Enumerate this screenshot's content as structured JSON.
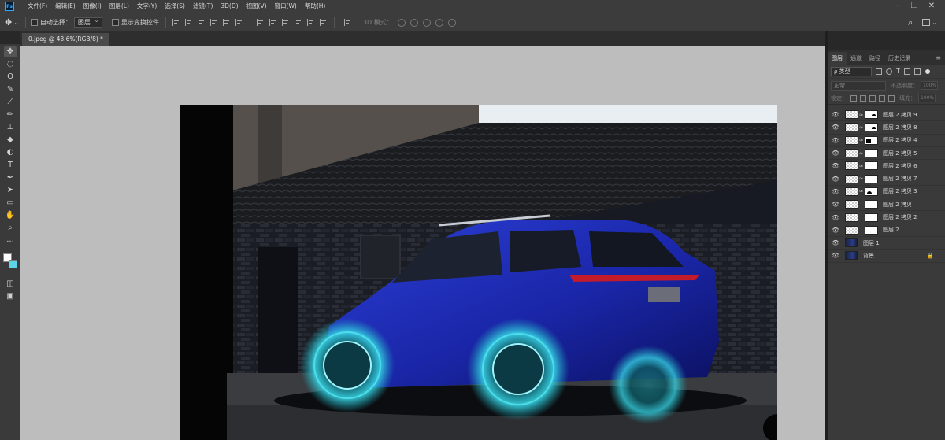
{
  "app": {
    "logo_text": "Ps"
  },
  "menu": [
    "文件(F)",
    "编辑(E)",
    "图像(I)",
    "图层(L)",
    "文字(Y)",
    "选择(S)",
    "滤镜(T)",
    "3D(D)",
    "视图(V)",
    "窗口(W)",
    "帮助(H)"
  ],
  "options": {
    "move_tool_icon": "move-icon",
    "auto_select_label": "自动选择：",
    "auto_select_value": "图层",
    "show_transform_label": "显示变换控件",
    "mode3d_label": "3D 模式："
  },
  "document": {
    "tab_title": "0.jpeg @ 48.6%(RGB/8) *"
  },
  "tools": [
    "move-icon",
    "marquee-icon",
    "lasso-icon",
    "quick-select-icon",
    "eyedropper-icon",
    "brush-icon",
    "stamp-icon",
    "eraser-icon",
    "bucket-icon",
    "text-icon",
    "pen-icon",
    "path-select-icon",
    "rectangle-icon",
    "hand-icon",
    "zoom-icon",
    "more-icon"
  ],
  "colors": {
    "foreground": "#ffffff",
    "background": "#5fd3e8",
    "canvas_bg": "#bdbdbd"
  },
  "panels": {
    "tabs": [
      "图层",
      "通道",
      "路径",
      "历史记录"
    ],
    "kind_label": "ρ 类型",
    "blend_mode": "正常",
    "opacity_label": "不透明度：",
    "opacity_value": "100%",
    "lock_label": "锁定：",
    "fill_label": "填充：",
    "fill_value": "100%"
  },
  "layers": [
    {
      "name": "图层 2 拷贝 9",
      "thumb": "transparent",
      "mask": "m1"
    },
    {
      "name": "图层 2 拷贝 8",
      "thumb": "transparent",
      "mask": "m1"
    },
    {
      "name": "图层 2 拷贝 4",
      "thumb": "transparent",
      "mask": "m2"
    },
    {
      "name": "图层 2 拷贝 5",
      "thumb": "transparent",
      "mask": "plain"
    },
    {
      "name": "图层 2 拷贝 6",
      "thumb": "transparent",
      "mask": "plain"
    },
    {
      "name": "图层 2 拷贝 7",
      "thumb": "transparent",
      "mask": "plain"
    },
    {
      "name": "图层 2 拷贝 3",
      "thumb": "transparent",
      "mask": "m3"
    },
    {
      "name": "图层 2 拷贝",
      "thumb": "transparent",
      "mask": "plain"
    },
    {
      "name": "图层 2 拷贝 2",
      "thumb": "transparent",
      "mask": "plain"
    },
    {
      "name": "图层 2",
      "thumb": "transparent",
      "mask": "plain"
    },
    {
      "name": "图层 1",
      "thumb": "photo",
      "mask": "none"
    },
    {
      "name": "背景",
      "thumb": "photo",
      "mask": "none",
      "locked": true
    }
  ]
}
